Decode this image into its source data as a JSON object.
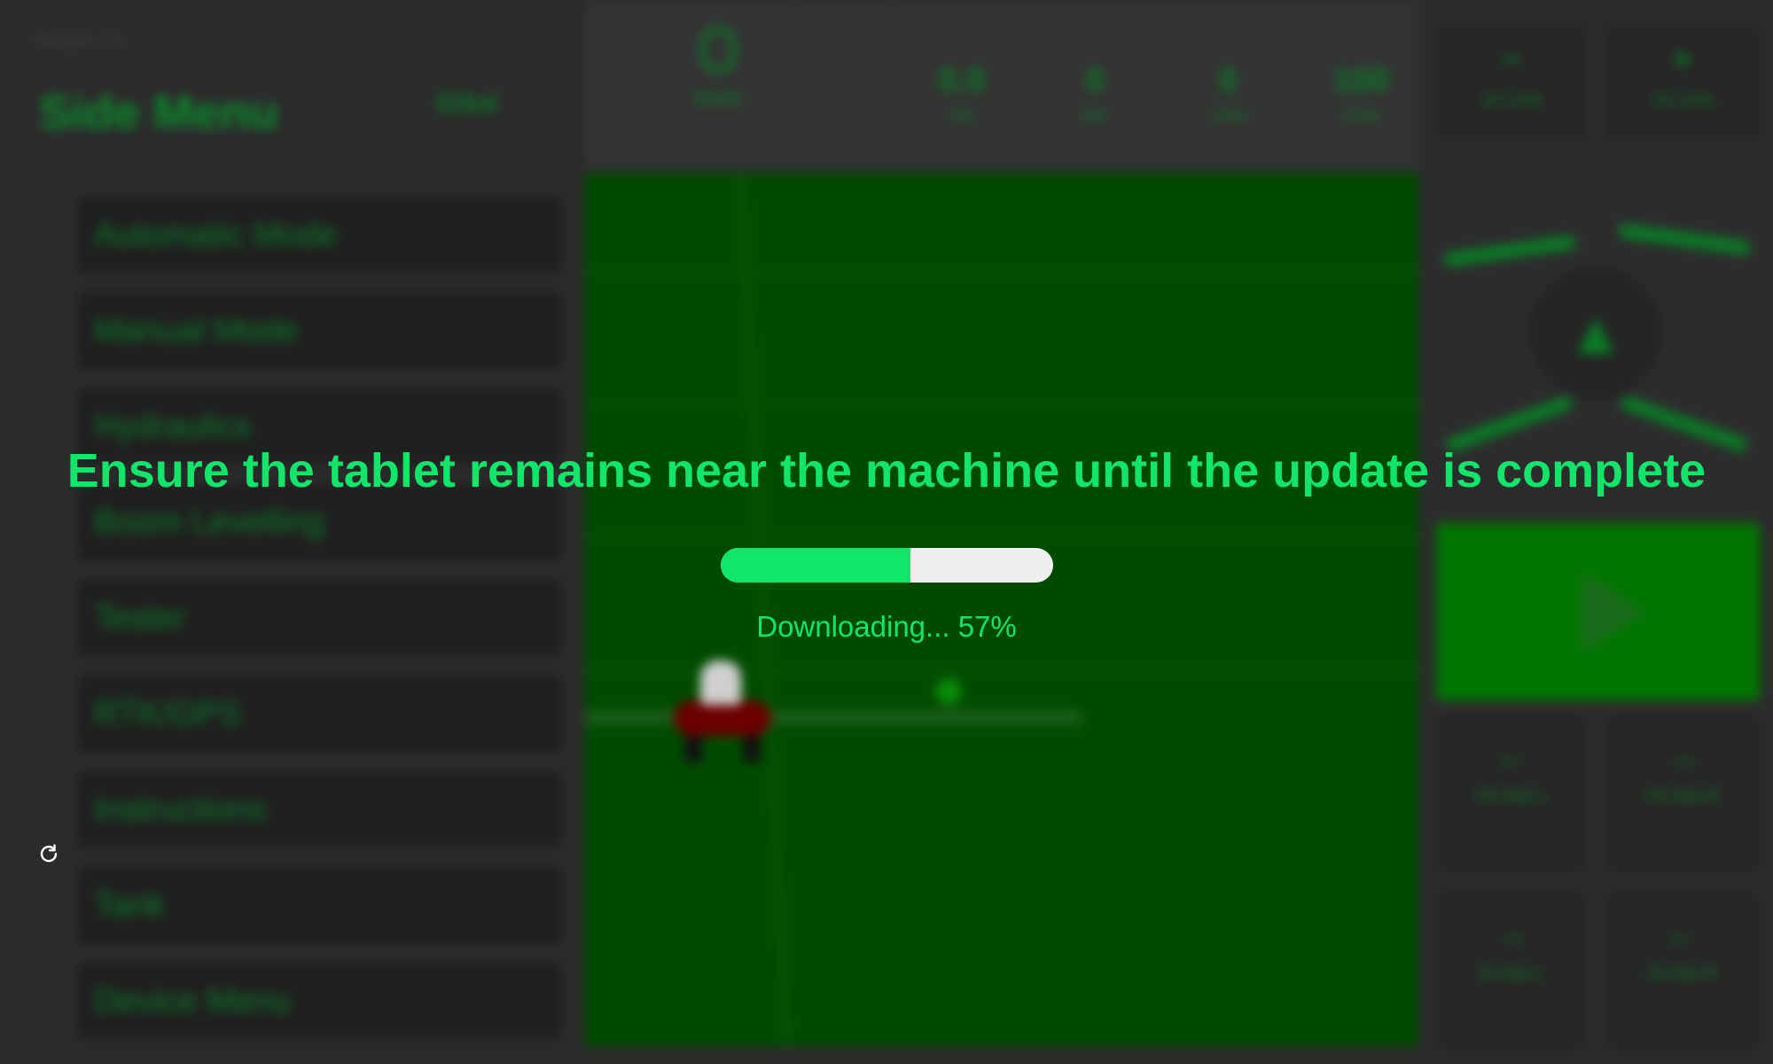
{
  "sidebar": {
    "version": "Version 1.0",
    "title": "Side Menu",
    "logo_text": "GSol",
    "items": [
      {
        "label": "Automatic Mode"
      },
      {
        "label": "Manual Mode"
      },
      {
        "label": "Hydraulics"
      },
      {
        "label": "Boom Levelling"
      },
      {
        "label": "Tester"
      },
      {
        "label": "RTK/GPS"
      },
      {
        "label": "Instructions"
      },
      {
        "label": "Tank"
      },
      {
        "label": "Device Menu"
      }
    ]
  },
  "topbar": {
    "mode_label": "Mode",
    "stats": [
      {
        "value": "0.0",
        "unit": "Ha"
      },
      {
        "value": "0",
        "unit": "bar"
      },
      {
        "value": "0",
        "unit": "L/Ha"
      },
      {
        "value": "100",
        "unit": "L/Ha"
      }
    ]
  },
  "rightpanel": {
    "top_tiles": [
      {
        "glyph": "−",
        "label": "10 L/Ha"
      },
      {
        "glyph": "+",
        "label": "10 L/Ha"
      }
    ],
    "bottom_tiles": [
      {
        "glyph": "←",
        "label": "VS Dist L"
      },
      {
        "glyph": "→",
        "label": "VS Dist R"
      },
      {
        "glyph": "→",
        "label": "IS Dist L"
      },
      {
        "glyph": "←",
        "label": "IS Dist R"
      }
    ]
  },
  "update": {
    "message": "Ensure the tablet remains near the machine until the update is complete",
    "progress_fraction": 0.57,
    "status_text": "Downloading... 57%"
  },
  "colors": {
    "accent": "#11e56a",
    "field": "#004b00",
    "background": "#2c2c2c"
  },
  "icons": {
    "refresh": "refresh-icon"
  }
}
